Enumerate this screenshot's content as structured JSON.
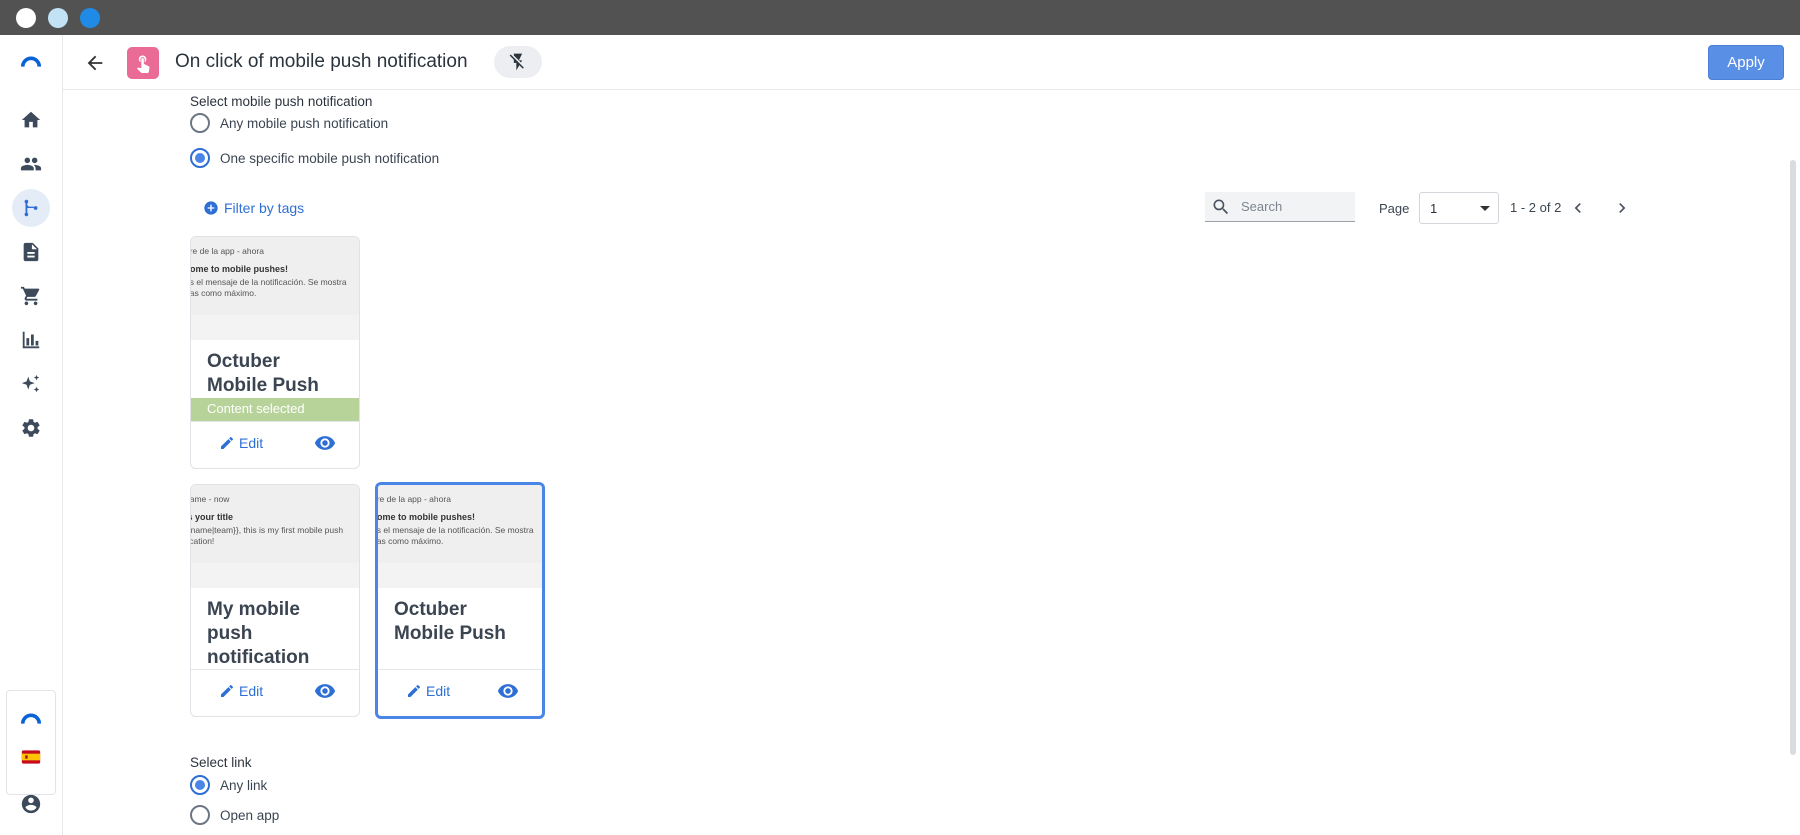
{
  "window": {
    "controls": [
      "close",
      "minimize",
      "maximize"
    ]
  },
  "sidebar": {
    "items": [
      {
        "name": "logo",
        "icon": "brevo-logo-icon"
      },
      {
        "name": "home",
        "icon": "home-icon"
      },
      {
        "name": "contacts",
        "icon": "contacts-icon"
      },
      {
        "name": "automations",
        "icon": "automation-icon",
        "active": true
      },
      {
        "name": "templates",
        "icon": "document-icon"
      },
      {
        "name": "ecommerce",
        "icon": "cart-icon"
      },
      {
        "name": "statistics",
        "icon": "bar-chart-icon"
      },
      {
        "name": "ai",
        "icon": "sparkle-icon"
      },
      {
        "name": "settings",
        "icon": "gear-icon"
      }
    ],
    "bottom": [
      {
        "name": "brand",
        "icon": "brevo-logo-icon"
      },
      {
        "name": "language",
        "icon": "spain-flag-icon"
      },
      {
        "name": "account",
        "icon": "account-icon"
      }
    ]
  },
  "header": {
    "title": "On click of mobile push notification",
    "apply_label": "Apply",
    "accent": "#5a8fe6",
    "trigger_color": "#ea6b95"
  },
  "push_selection": {
    "label": "Select mobile push notification",
    "options": [
      {
        "label": "Any mobile push notification",
        "checked": false
      },
      {
        "label": "One specific mobile push notification",
        "checked": true
      }
    ]
  },
  "toolbar": {
    "filter_label": "Filter by tags",
    "search_placeholder": "Search",
    "page_label": "Page",
    "page_value": "1",
    "range_label": "1 - 2 of 2"
  },
  "cards": [
    {
      "preview": {
        "line1": "bre de la app - ahora",
        "line2": "come to mobile pushes!",
        "line3": "es el mensaje de la notificación. Se mostra",
        "line4": "eas como máximo."
      },
      "name": "Octuber Mobile Push",
      "selected_label": "Content selected",
      "edit_label": "Edit"
    },
    {
      "preview": {
        "line1": "name - now",
        "line2": "is your title",
        "line3": "{{name|team}}, this is my first mobile push",
        "line4": "fication!"
      },
      "name": "My mobile push notification",
      "edit_label": "Edit"
    },
    {
      "preview": {
        "line1": "bre de la app - ahora",
        "line2": "come to mobile pushes!",
        "line3": "es el mensaje de la notificación. Se mostra",
        "line4": "eas como máximo."
      },
      "name": "Octuber Mobile Push",
      "edit_label": "Edit",
      "highlighted": true
    }
  ],
  "link_selection": {
    "label": "Select link",
    "options": [
      {
        "label": "Any link",
        "checked": true
      },
      {
        "label": "Open app",
        "checked": false
      }
    ]
  }
}
